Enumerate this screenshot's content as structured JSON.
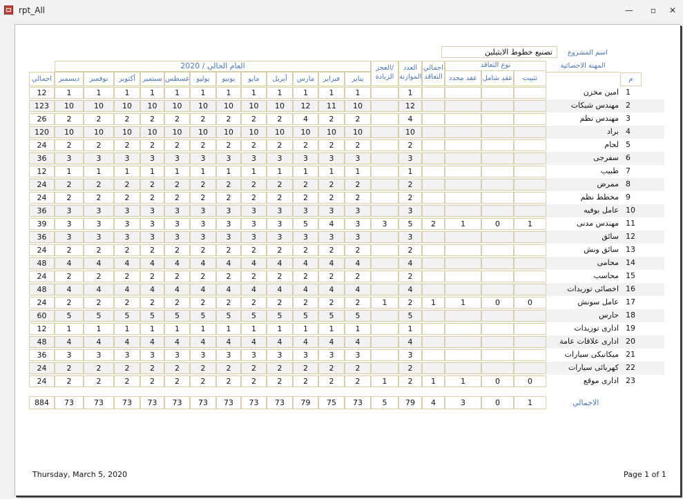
{
  "window": {
    "title": "rpt_All",
    "minimize": "—",
    "restore": "▫",
    "close": "✕"
  },
  "report": {
    "project_label": "اسم المشروع",
    "project_name": "تصنيع خطوط الايثيلين",
    "headers": {
      "profession": "المهنة الاحصائية",
      "num": "م",
      "contract_type": "نوع التعاقد",
      "permanent": "تثبيت",
      "comprehensive": "عقد شامل",
      "fixed_term": "عقد محدد",
      "contract_total_1": "اجمالي",
      "contract_total_2": "التعاقد",
      "budget_1": "العدد",
      "budget_2": "بالموازنة",
      "deficit_1": "العجز/",
      "deficit_2": "الزيادة",
      "current_year": "العام الحالي / 2020",
      "months": [
        "يناير",
        "فبراير",
        "مارس",
        "أبريل",
        "مايو",
        "يونيو",
        "يوليو",
        "أغسطس",
        "سبتمبر",
        "أكتوبر",
        "نوفمبر",
        "ديسمبر"
      ],
      "total": "اجمالي"
    },
    "rows": [
      {
        "n": "1",
        "name": "امين مخزن",
        "perm": "",
        "comp": "",
        "fixed": "",
        "ct": "",
        "budget": "1",
        "def": "",
        "months": [
          "1",
          "1",
          "1",
          "1",
          "1",
          "1",
          "1",
          "1",
          "1",
          "1",
          "1",
          "1"
        ],
        "total": "12"
      },
      {
        "n": "2",
        "name": "مهندس شبكات",
        "perm": "",
        "comp": "",
        "fixed": "",
        "ct": "",
        "budget": "12",
        "def": "",
        "months": [
          "10",
          "11",
          "12",
          "10",
          "10",
          "10",
          "10",
          "10",
          "10",
          "10",
          "10",
          "10"
        ],
        "total": "123"
      },
      {
        "n": "3",
        "name": "مهندس نظم",
        "perm": "",
        "comp": "",
        "fixed": "",
        "ct": "",
        "budget": "4",
        "def": "",
        "months": [
          "2",
          "2",
          "4",
          "2",
          "2",
          "2",
          "2",
          "2",
          "2",
          "2",
          "2",
          "2"
        ],
        "total": "26"
      },
      {
        "n": "4",
        "name": "براد",
        "perm": "",
        "comp": "",
        "fixed": "",
        "ct": "",
        "budget": "10",
        "def": "",
        "months": [
          "10",
          "10",
          "10",
          "10",
          "10",
          "10",
          "10",
          "10",
          "10",
          "10",
          "10",
          "10"
        ],
        "total": "120"
      },
      {
        "n": "5",
        "name": "لحام",
        "perm": "",
        "comp": "",
        "fixed": "",
        "ct": "",
        "budget": "2",
        "def": "",
        "months": [
          "2",
          "2",
          "2",
          "2",
          "2",
          "2",
          "2",
          "2",
          "2",
          "2",
          "2",
          "2"
        ],
        "total": "24"
      },
      {
        "n": "6",
        "name": "سفرجى",
        "perm": "",
        "comp": "",
        "fixed": "",
        "ct": "",
        "budget": "3",
        "def": "",
        "months": [
          "3",
          "3",
          "3",
          "3",
          "3",
          "3",
          "3",
          "3",
          "3",
          "3",
          "3",
          "3"
        ],
        "total": "36"
      },
      {
        "n": "7",
        "name": "طبيب",
        "perm": "",
        "comp": "",
        "fixed": "",
        "ct": "",
        "budget": "1",
        "def": "",
        "months": [
          "1",
          "1",
          "1",
          "1",
          "1",
          "1",
          "1",
          "1",
          "1",
          "1",
          "1",
          "1"
        ],
        "total": "12"
      },
      {
        "n": "8",
        "name": "ممرض",
        "perm": "",
        "comp": "",
        "fixed": "",
        "ct": "",
        "budget": "2",
        "def": "",
        "months": [
          "2",
          "2",
          "2",
          "2",
          "2",
          "2",
          "2",
          "2",
          "2",
          "2",
          "2",
          "2"
        ],
        "total": "24"
      },
      {
        "n": "9",
        "name": "مخطط نظم",
        "perm": "",
        "comp": "",
        "fixed": "",
        "ct": "",
        "budget": "2",
        "def": "",
        "months": [
          "2",
          "2",
          "2",
          "2",
          "2",
          "2",
          "2",
          "2",
          "2",
          "2",
          "2",
          "2"
        ],
        "total": "24"
      },
      {
        "n": "10",
        "name": "عامل بوفيه",
        "perm": "",
        "comp": "",
        "fixed": "",
        "ct": "",
        "budget": "3",
        "def": "",
        "months": [
          "3",
          "3",
          "3",
          "3",
          "3",
          "3",
          "3",
          "3",
          "3",
          "3",
          "3",
          "3"
        ],
        "total": "36"
      },
      {
        "n": "11",
        "name": "مهندس مدنى",
        "perm": "1",
        "comp": "0",
        "fixed": "1",
        "ct": "2",
        "budget": "5",
        "def": "3",
        "months": [
          "3",
          "4",
          "5",
          "3",
          "3",
          "3",
          "3",
          "3",
          "3",
          "3",
          "3",
          "3"
        ],
        "total": "39"
      },
      {
        "n": "12",
        "name": "سائق",
        "perm": "",
        "comp": "",
        "fixed": "",
        "ct": "",
        "budget": "3",
        "def": "",
        "months": [
          "3",
          "3",
          "3",
          "3",
          "3",
          "3",
          "3",
          "3",
          "3",
          "3",
          "3",
          "3"
        ],
        "total": "36"
      },
      {
        "n": "13",
        "name": "سائق ونش",
        "perm": "",
        "comp": "",
        "fixed": "",
        "ct": "",
        "budget": "2",
        "def": "",
        "months": [
          "2",
          "2",
          "2",
          "2",
          "2",
          "2",
          "2",
          "2",
          "2",
          "2",
          "2",
          "2"
        ],
        "total": "24"
      },
      {
        "n": "14",
        "name": "محامى",
        "perm": "",
        "comp": "",
        "fixed": "",
        "ct": "",
        "budget": "4",
        "def": "",
        "months": [
          "4",
          "4",
          "4",
          "4",
          "4",
          "4",
          "4",
          "4",
          "4",
          "4",
          "4",
          "4"
        ],
        "total": "48"
      },
      {
        "n": "15",
        "name": "محاسب",
        "perm": "",
        "comp": "",
        "fixed": "",
        "ct": "",
        "budget": "2",
        "def": "",
        "months": [
          "2",
          "2",
          "2",
          "2",
          "2",
          "2",
          "2",
          "2",
          "2",
          "2",
          "2",
          "2"
        ],
        "total": "24"
      },
      {
        "n": "16",
        "name": "اخصائى توريدات",
        "perm": "",
        "comp": "",
        "fixed": "",
        "ct": "",
        "budget": "4",
        "def": "",
        "months": [
          "4",
          "4",
          "4",
          "4",
          "4",
          "4",
          "4",
          "4",
          "4",
          "4",
          "4",
          "4"
        ],
        "total": "48"
      },
      {
        "n": "17",
        "name": "عامل سونش",
        "perm": "0",
        "comp": "0",
        "fixed": "1",
        "ct": "1",
        "budget": "2",
        "def": "1",
        "months": [
          "2",
          "2",
          "2",
          "2",
          "2",
          "2",
          "2",
          "2",
          "2",
          "2",
          "2",
          "2"
        ],
        "total": "24"
      },
      {
        "n": "18",
        "name": "حارس",
        "perm": "",
        "comp": "",
        "fixed": "",
        "ct": "",
        "budget": "5",
        "def": "",
        "months": [
          "5",
          "5",
          "5",
          "5",
          "5",
          "5",
          "5",
          "5",
          "5",
          "5",
          "5",
          "5"
        ],
        "total": "60"
      },
      {
        "n": "19",
        "name": "ادارى توريدات",
        "perm": "",
        "comp": "",
        "fixed": "",
        "ct": "",
        "budget": "1",
        "def": "",
        "months": [
          "1",
          "1",
          "1",
          "1",
          "1",
          "1",
          "1",
          "1",
          "1",
          "1",
          "1",
          "1"
        ],
        "total": "12"
      },
      {
        "n": "20",
        "name": "ادارى علاقات عامة",
        "perm": "",
        "comp": "",
        "fixed": "",
        "ct": "",
        "budget": "4",
        "def": "",
        "months": [
          "4",
          "4",
          "4",
          "4",
          "4",
          "4",
          "4",
          "4",
          "4",
          "4",
          "4",
          "4"
        ],
        "total": "48"
      },
      {
        "n": "21",
        "name": "ميكانيكى سيارات",
        "perm": "",
        "comp": "",
        "fixed": "",
        "ct": "",
        "budget": "3",
        "def": "",
        "months": [
          "3",
          "3",
          "3",
          "3",
          "3",
          "3",
          "3",
          "3",
          "3",
          "3",
          "3",
          "3"
        ],
        "total": "36"
      },
      {
        "n": "22",
        "name": "كهربائى سيارات",
        "perm": "",
        "comp": "",
        "fixed": "",
        "ct": "",
        "budget": "2",
        "def": "",
        "months": [
          "2",
          "2",
          "2",
          "2",
          "2",
          "2",
          "2",
          "2",
          "2",
          "2",
          "2",
          "2"
        ],
        "total": "24"
      },
      {
        "n": "23",
        "name": "ادارى موقع",
        "perm": "0",
        "comp": "0",
        "fixed": "1",
        "ct": "1",
        "budget": "2",
        "def": "1",
        "months": [
          "2",
          "2",
          "2",
          "2",
          "2",
          "2",
          "2",
          "2",
          "2",
          "2",
          "2",
          "2"
        ],
        "total": "24"
      }
    ],
    "totals": {
      "label": "الاجمالي",
      "perm": "1",
      "comp": "0",
      "fixed": "3",
      "ct": "4",
      "budget": "79",
      "def": "5",
      "months": [
        "73",
        "75",
        "79",
        "73",
        "73",
        "73",
        "73",
        "73",
        "73",
        "73",
        "73",
        "73"
      ],
      "total": "884"
    },
    "footer": {
      "date": "Thursday, March 5, 2020",
      "page": "Page 1 of 1"
    }
  }
}
